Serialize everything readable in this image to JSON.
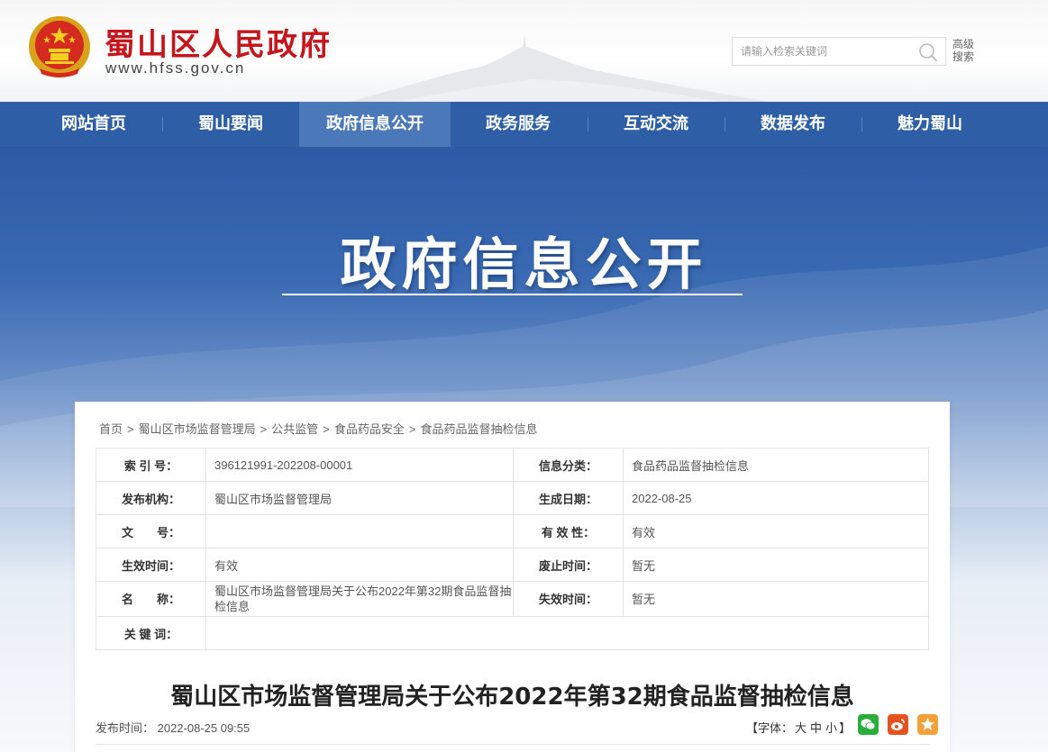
{
  "header": {
    "site_title": "蜀山区人民政府",
    "site_url": "www.hfss.gov.cn",
    "search_placeholder": "请输入检索关键词",
    "advanced_search": "高级搜索"
  },
  "nav": {
    "items": [
      "网站首页",
      "蜀山要闻",
      "政府信息公开",
      "政务服务",
      "互动交流",
      "数据发布",
      "魅力蜀山"
    ],
    "active": "政府信息公开"
  },
  "banner": {
    "title": "政府信息公开"
  },
  "breadcrumb": [
    "首页",
    "蜀山区市场监督管理局",
    "公共监管",
    "食品药品安全",
    "食品药品监督抽检信息"
  ],
  "meta": {
    "index_label": "索 引 号：",
    "index_value": "396121991-202208-00001",
    "category_label": "信息分类：",
    "category_value": "食品药品监督抽检信息",
    "org_label": "发布机构：",
    "org_value": "蜀山区市场监督管理局",
    "date_label": "生成日期：",
    "date_value": "2022-08-25",
    "docno_label": "文　　号：",
    "docno_value": "",
    "validity_label": "有 效 性：",
    "validity_value": "有效",
    "effective_label": "生效时间：",
    "effective_value": "有效",
    "repeal_label": "废止时间：",
    "repeal_value": "暂无",
    "name_label": "名　　称：",
    "name_value": "蜀山区市场监督管理局关于公布2022年第32期食品监督抽检信息",
    "expire_label": "失效时间：",
    "expire_value": "暂无",
    "keywords_label": "关 键 词：",
    "keywords_value": ""
  },
  "article": {
    "title": "蜀山区市场监督管理局关于公布2022年第32期食品监督抽检信息",
    "publish_time": "发布时间： 2022-08-25 09:55",
    "font_label_open": "【字体：",
    "font_large": "大",
    "font_medium": "中",
    "font_small": "小",
    "font_label_close": "】"
  },
  "colors": {
    "brand_red": "#c4161c",
    "nav_blue": "#2e5fa6",
    "wechat": "#2aae3a",
    "weibo": "#e6521d",
    "favorite": "#f3a23a"
  }
}
